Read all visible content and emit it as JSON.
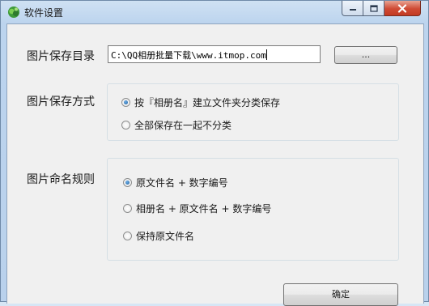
{
  "window": {
    "title": "软件设置",
    "icon": "app-logo-icon"
  },
  "save_dir": {
    "label": "图片保存目录",
    "value": "C:\\QQ相册批量下载\\www.itmop.com",
    "browse_label": "..."
  },
  "save_mode": {
    "label": "图片保存方式",
    "options": [
      {
        "label": "按『相册名』建立文件夹分类保存",
        "checked": true
      },
      {
        "label": "全部保存在一起不分类",
        "checked": false
      }
    ]
  },
  "naming": {
    "label": "图片命名规则",
    "options": [
      {
        "label": "原文件名 + 数字编号",
        "checked": true
      },
      {
        "label": "相册名 + 原文件名 + 数字编号",
        "checked": false
      },
      {
        "label": "保持原文件名",
        "checked": false
      }
    ]
  },
  "footer": {
    "ok_label": "确定"
  },
  "colors": {
    "close_button": "#cf4a34",
    "radio_checked": "#1c5d9c"
  }
}
